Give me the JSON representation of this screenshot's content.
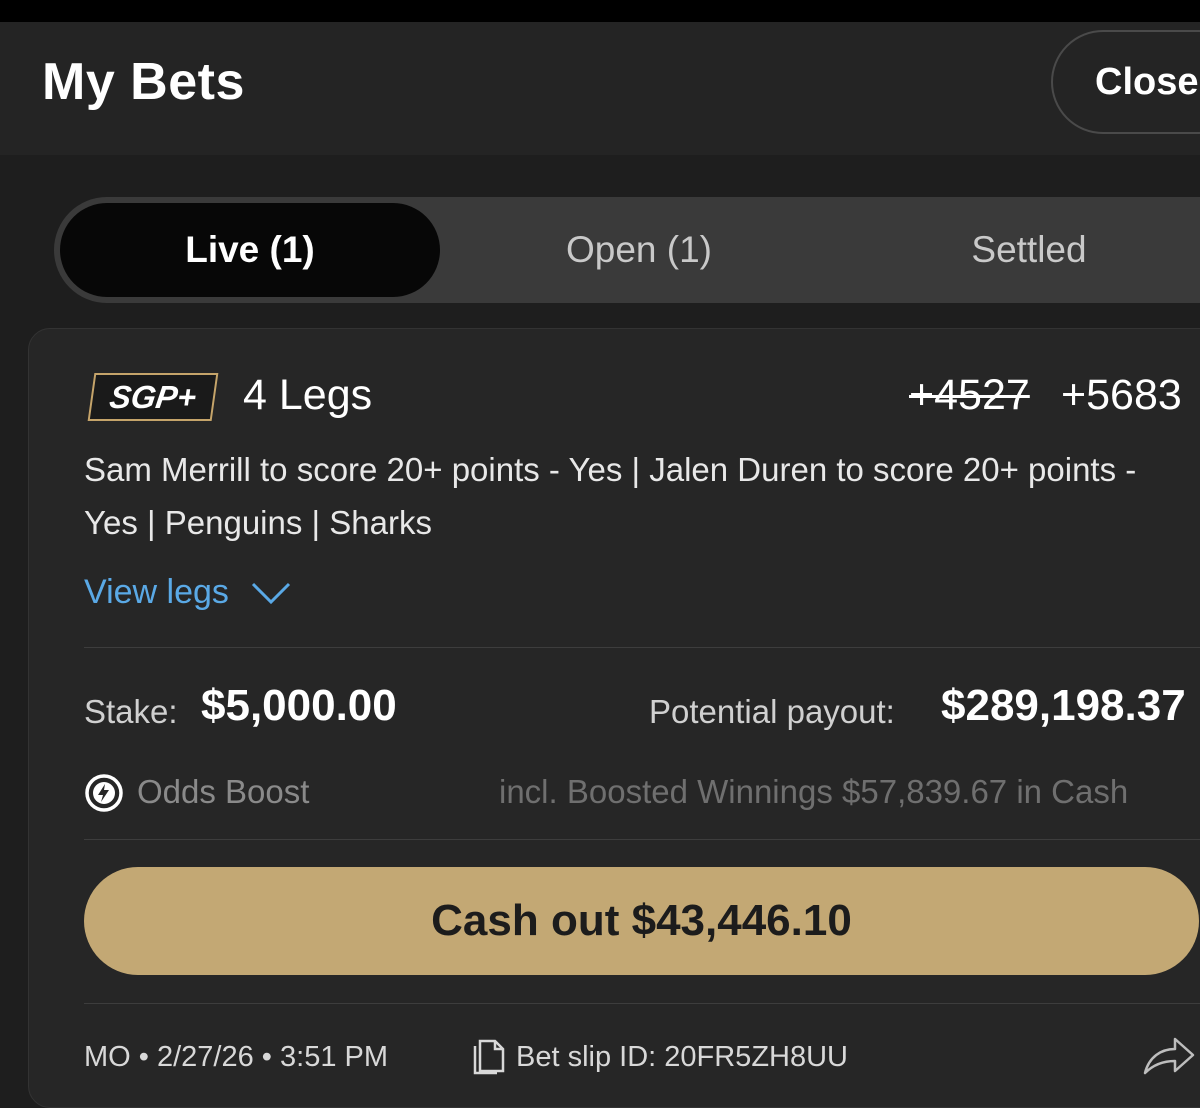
{
  "header": {
    "title": "My Bets",
    "close_label": "Close"
  },
  "tabs": [
    {
      "label": "Live (1)",
      "active": true
    },
    {
      "label": "Open (1)",
      "active": false
    },
    {
      "label": "Settled",
      "active": false
    }
  ],
  "bet": {
    "badge": "SGP+",
    "legs_title": "4 Legs",
    "odds_original": "+4527",
    "odds_boosted": "+5683",
    "description": "Sam Merrill to score 20+ points - Yes | Jalen Duren to score 20+ points - Yes | Penguins | Sharks",
    "view_legs_label": "View legs",
    "stake_label": "Stake:",
    "stake_value": "$5,000.00",
    "payout_label": "Potential payout:",
    "payout_value": "$289,198.37",
    "boost_label": "Odds Boost",
    "boost_winnings": "incl. Boosted Winnings $57,839.67 in Cash",
    "cashout_label": "Cash out $43,446.10",
    "meta_info": "MO • 2/27/26 • 3:51 PM",
    "bet_slip_id": "Bet slip ID: 20FR5ZH8UU"
  },
  "colors": {
    "accent_gold": "#c3a874",
    "link_blue": "#5aa9e6",
    "badge_border": "#c5a46a"
  },
  "icons": [
    "chevron-down-icon",
    "lightning-icon",
    "document-icon",
    "share-icon"
  ]
}
